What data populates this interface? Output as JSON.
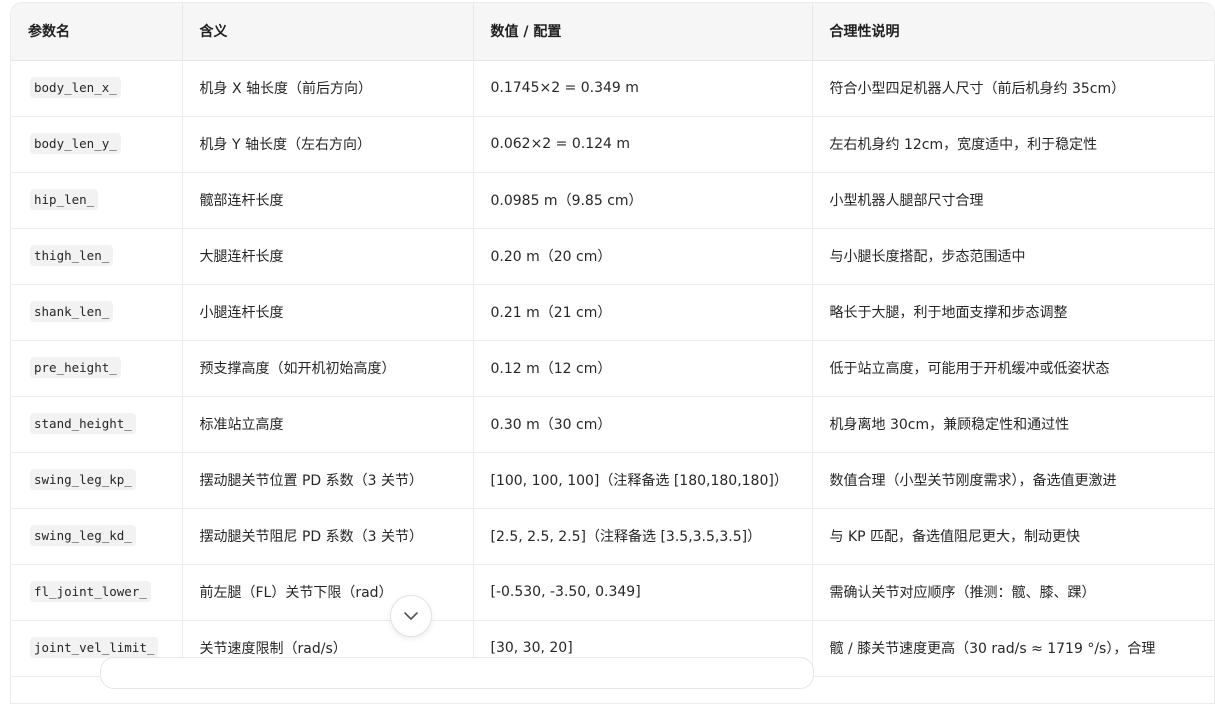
{
  "table": {
    "headers": [
      "参数名",
      "含义",
      "数值 / 配置",
      "合理性说明"
    ],
    "rows": [
      {
        "param": "body_len_x_",
        "meaning": "机身 X 轴长度（前后方向）",
        "value": "0.1745×2 = 0.349 m",
        "note": "符合小型四足机器人尺寸（前后机身约 35cm）"
      },
      {
        "param": "body_len_y_",
        "meaning": "机身 Y 轴长度（左右方向）",
        "value": "0.062×2 = 0.124 m",
        "note": "左右机身约 12cm，宽度适中，利于稳定性"
      },
      {
        "param": "hip_len_",
        "meaning": "髋部连杆长度",
        "value": "0.0985 m（9.85 cm）",
        "note": "小型机器人腿部尺寸合理"
      },
      {
        "param": "thigh_len_",
        "meaning": "大腿连杆长度",
        "value": "0.20 m（20 cm）",
        "note": "与小腿长度搭配，步态范围适中"
      },
      {
        "param": "shank_len_",
        "meaning": "小腿连杆长度",
        "value": "0.21 m（21 cm）",
        "note": "略长于大腿，利于地面支撑和步态调整"
      },
      {
        "param": "pre_height_",
        "meaning": "预支撑高度（如开机初始高度）",
        "value": "0.12 m（12 cm）",
        "note": "低于站立高度，可能用于开机缓冲或低姿状态"
      },
      {
        "param": "stand_height_",
        "meaning": "标准站立高度",
        "value": "0.30 m（30 cm）",
        "note": "机身离地 30cm，兼顾稳定性和通过性"
      },
      {
        "param": "swing_leg_kp_",
        "meaning": "摆动腿关节位置 PD 系数（3 关节）",
        "value": "[100, 100, 100]（注释备选 [180,180,180]）",
        "note": "数值合理（小型关节刚度需求），备选值更激进"
      },
      {
        "param": "swing_leg_kd_",
        "meaning": "摆动腿关节阻尼 PD 系数（3 关节）",
        "value": "[2.5, 2.5, 2.5]（注释备选 [3.5,3.5,3.5]）",
        "note": "与 KP 匹配，备选值阻尼更大，制动更快"
      },
      {
        "param": "fl_joint_lower_",
        "meaning": "前左腿（FL）关节下限（rad）",
        "value": "[-0.530, -3.50, 0.349]",
        "note": "需确认关节对应顺序（推测：髋、膝、踝）"
      },
      {
        "param": "joint_vel_limit_",
        "meaning": "关节速度限制（rad/s）",
        "value": "[30, 30, 20]",
        "note": "髋 / 膝关节速度更高（30 rad/s ≈ 1719 °/s），合理"
      }
    ]
  },
  "controls": {
    "scroll_down_icon": "chevron-down-icon"
  }
}
